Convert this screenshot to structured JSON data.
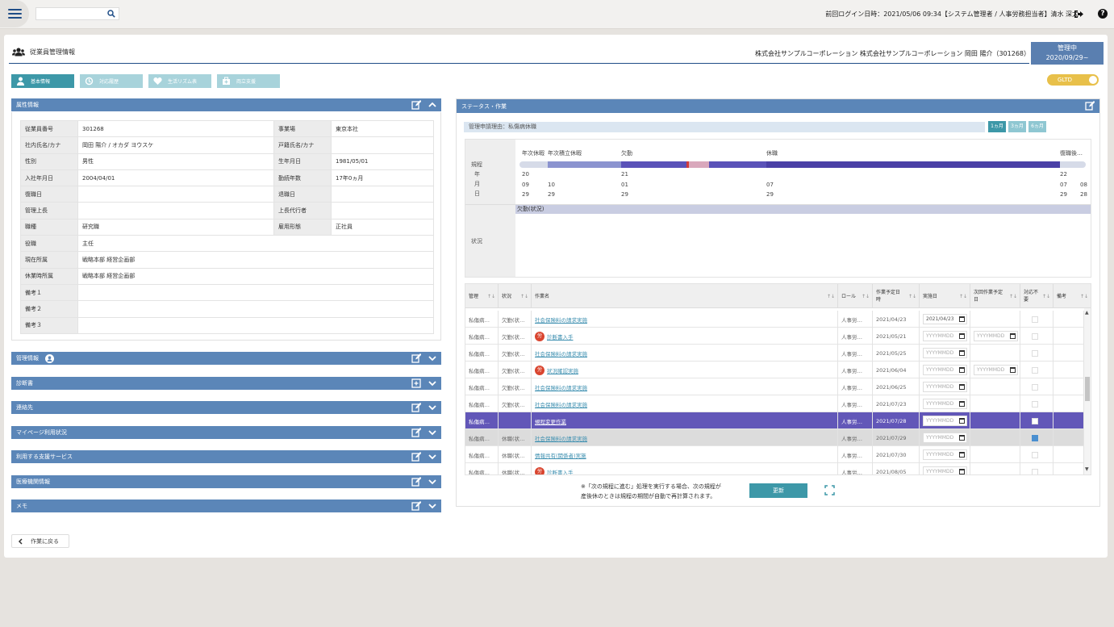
{
  "topbar": {
    "search_placeholder": "",
    "login_info": "前回ログイン日時：2021/05/06 09:34【システム管理者 / 人事労務担当者】清水 深太"
  },
  "header": {
    "title": "従業員管理情報",
    "company_user": "株式会社サンプルコーポレーション 株式会社サンプルコーポレーション 岡田 陽介（301268）",
    "status_label": "管理中",
    "status_date": "2020/09/29~"
  },
  "tabs": [
    {
      "label": "基本情報",
      "icon": "person-icon"
    },
    {
      "label": "対応履歴",
      "icon": "history-icon"
    },
    {
      "label": "生活リズム表",
      "icon": "heart-icon"
    },
    {
      "label": "両立支援",
      "icon": "medical-bag-icon"
    }
  ],
  "toggle_label": "GLTD",
  "attributes": {
    "title": "属性情報",
    "rows": [
      {
        "l1": "従業員番号",
        "v1": "301268",
        "l2": "事業場",
        "v2": "東京本社"
      },
      {
        "l1": "社内氏名/カナ",
        "v1": "岡田 陽介 / オカダ ヨウスケ",
        "l2": "戸籍氏名/カナ",
        "v2": ""
      },
      {
        "l1": "性別",
        "v1": "男性",
        "l2": "生年月日",
        "v2": "1981/05/01"
      },
      {
        "l1": "入社年月日",
        "v1": "2004/04/01",
        "l2": "勤続年数",
        "v2": "17年0ヵ月"
      },
      {
        "l1": "復職日",
        "v1": "",
        "l2": "退職日",
        "v2": ""
      },
      {
        "l1": "管理上長",
        "v1": "",
        "l2": "上長代行者",
        "v2": ""
      },
      {
        "l1": "職種",
        "v1": "研究職",
        "l2": "雇用形態",
        "v2": "正社員"
      },
      {
        "l1": "役職",
        "v1": "主任"
      },
      {
        "l1": "現在所属",
        "v1": "戦略本部 経営企画部"
      },
      {
        "l1": "休業時所属",
        "v1": "戦略本部 経営企画部"
      },
      {
        "l1": "備考１",
        "v1": ""
      },
      {
        "l1": "備考２",
        "v1": ""
      },
      {
        "l1": "備考３",
        "v1": ""
      }
    ]
  },
  "panels": {
    "management": "管理情報",
    "diagnosis": "診断書",
    "contacts": "連絡先",
    "mypage": "マイページ利用状況",
    "services": "利用する支援サービス",
    "medical": "医療機関情報",
    "memo": "メモ"
  },
  "back_label": "作業に戻る",
  "status_panel": {
    "title": "ステータス・作業",
    "reason": "管理申請理由：私傷病休職",
    "periods": [
      "1ヵ月",
      "3ヵ月",
      "6ヵ月"
    ],
    "gantt": {
      "row_label_rule": "規程",
      "row_label_year": "年",
      "row_label_month": "月",
      "row_label_day": "日",
      "row_label_status": "状況",
      "phases": [
        "年次休暇",
        "年次積立休暇",
        "欠勤",
        "休職",
        "復職後…"
      ],
      "years": [
        "20",
        "21",
        "22"
      ],
      "months": [
        "09",
        "10",
        "01",
        "07",
        "07",
        "08"
      ],
      "days": [
        "29",
        "29",
        "29",
        "29",
        "29",
        "28"
      ],
      "status_text": "欠勤(状況)"
    },
    "columns": [
      "管理",
      "状況",
      "作業名",
      "ロール",
      "作業予定日時",
      "実施日",
      "次回作業予定日",
      "対応不要",
      "備考"
    ],
    "rows": [
      {
        "mgmt": "私傷病…",
        "state": "欠勤(状…",
        "task": "社会保険料の請求実施",
        "badge": "",
        "role": "人事労…",
        "planned": "2021/04/23",
        "done": "2021/04/23",
        "next": "",
        "noneed": false
      },
      {
        "mgmt": "私傷病…",
        "state": "欠勤(状…",
        "task": "診断書入手",
        "badge": "労",
        "role": "人事労…",
        "planned": "2021/05/21",
        "done": "YYYYMMDD",
        "next": "YYYYMMDD",
        "noneed": false
      },
      {
        "mgmt": "私傷病…",
        "state": "欠勤(状…",
        "task": "社会保険料の請求実施",
        "badge": "",
        "role": "人事労…",
        "planned": "2021/05/25",
        "done": "YYYYMMDD",
        "next": "",
        "noneed": false
      },
      {
        "mgmt": "私傷病…",
        "state": "欠勤(状…",
        "task": "状況確認実施",
        "badge": "労",
        "role": "人事労…",
        "planned": "2021/06/04",
        "done": "YYYYMMDD",
        "next": "YYYYMMDD",
        "noneed": false
      },
      {
        "mgmt": "私傷病…",
        "state": "欠勤(状…",
        "task": "社会保険料の請求実施",
        "badge": "",
        "role": "人事労…",
        "planned": "2021/06/25",
        "done": "YYYYMMDD",
        "next": "",
        "noneed": false
      },
      {
        "mgmt": "私傷病…",
        "state": "欠勤(状…",
        "task": "社会保険料の請求実施",
        "badge": "",
        "role": "人事労…",
        "planned": "2021/07/23",
        "done": "YYYYMMDD",
        "next": "",
        "noneed": false
      },
      {
        "mgmt": "私傷病…",
        "state": "",
        "task": "規程変更作業",
        "badge": "",
        "role": "人事労…",
        "planned": "2021/07/28",
        "done": "YYYYMMDD",
        "next": "",
        "noneed": false
      },
      {
        "mgmt": "私傷病…",
        "state": "休職(状…",
        "task": "社会保険料の請求実施",
        "badge": "",
        "role": "人事労…",
        "planned": "2021/07/29",
        "done": "YYYYMMDD",
        "next": "",
        "noneed": true
      },
      {
        "mgmt": "私傷病…",
        "state": "休職(状…",
        "task": "情報共有(関係者)実施",
        "badge": "",
        "role": "人事労…",
        "planned": "2021/07/30",
        "done": "YYYYMMDD",
        "next": "",
        "noneed": false
      },
      {
        "mgmt": "私傷病…",
        "state": "休職(状…",
        "task": "診断書入手",
        "badge": "労",
        "role": "人事労…",
        "planned": "2021/08/05",
        "done": "YYYYMMDD",
        "next": "",
        "noneed": false
      }
    ],
    "note_line1": "※「次の規程に進む」処理を実行する場合、次の規程が",
    "note_line2": "産後休のときは規程の期間が自動で再計算されます。",
    "update_label": "更新"
  }
}
